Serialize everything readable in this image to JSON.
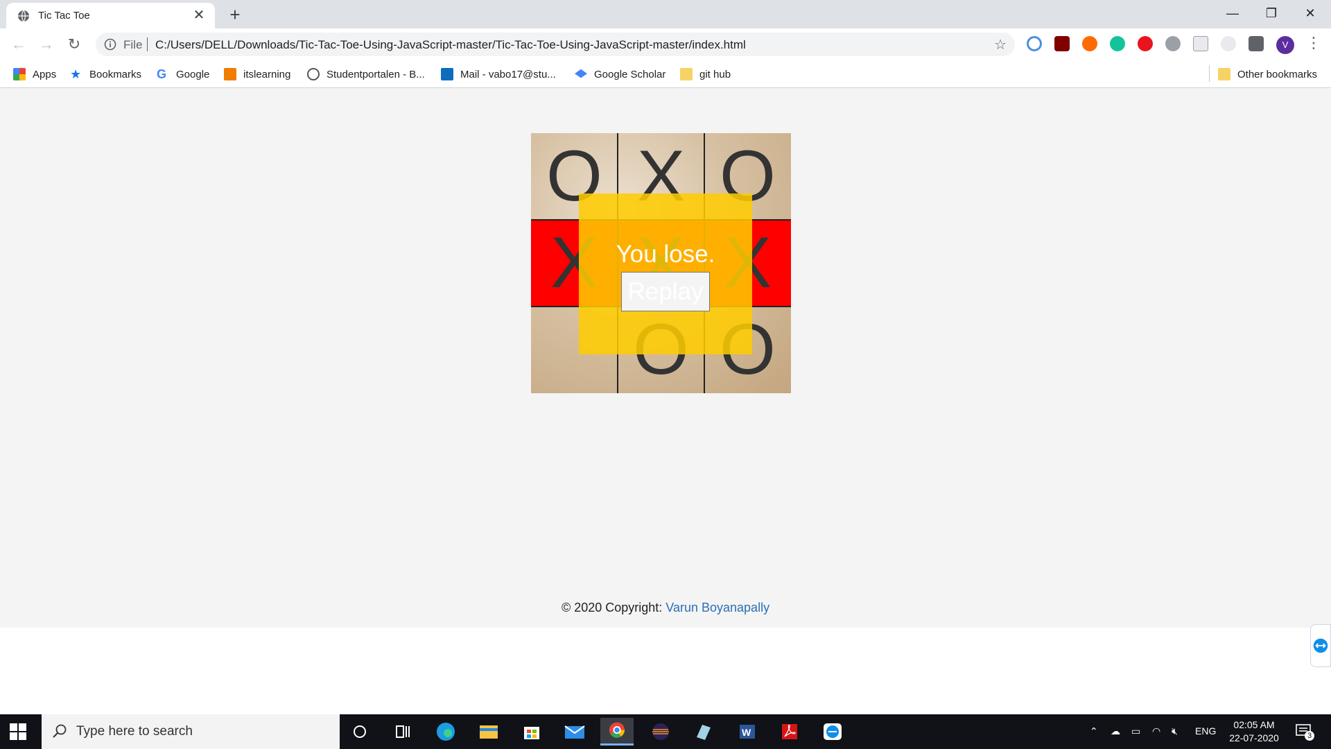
{
  "browser": {
    "tab_title": "Tic Tac Toe",
    "tab_close": "✕",
    "new_tab": "+",
    "window_minimize": "—",
    "window_restore": "❐",
    "window_close": "✕",
    "scheme_label": "File",
    "url": "C:/Users/DELL/Downloads/Tic-Tac-Toe-Using-JavaScript-master/Tic-Tac-Toe-Using-JavaScript-master/index.html",
    "profile_initial": "V",
    "bookmarks": [
      {
        "label": "Apps",
        "icon": "apps-grid-icon",
        "color": "#ea4335"
      },
      {
        "label": "Bookmarks",
        "icon": "star-icon",
        "color": "#1a73e8"
      },
      {
        "label": "Google",
        "icon": "google-icon",
        "color": "#4285f4"
      },
      {
        "label": "itslearning",
        "icon": "itslearning-icon",
        "color": "#f07c00"
      },
      {
        "label": "Studentportalen - B...",
        "icon": "studentportalen-icon",
        "color": "#555555"
      },
      {
        "label": "Mail - vabo17@stu...",
        "icon": "outlook-icon",
        "color": "#0f6cbd"
      },
      {
        "label": "Google Scholar",
        "icon": "scholar-icon",
        "color": "#4285f4"
      },
      {
        "label": "git hub",
        "icon": "folder-icon",
        "color": "#f6d365"
      }
    ],
    "other_bookmarks": "Other bookmarks"
  },
  "game": {
    "board": [
      "O",
      "X",
      "O",
      "X",
      "X",
      "X",
      "",
      "O",
      "O"
    ],
    "winning_row": [
      3,
      4,
      5
    ],
    "result_text": "You lose.",
    "replay_label": "Replay"
  },
  "footer": {
    "copyright_prefix": "© 2020 Copyright: ",
    "author": "Varun Boyanapally"
  },
  "taskbar": {
    "search_placeholder": "Type here to search",
    "language": "ENG",
    "time": "02:05 AM",
    "date": "22-07-2020",
    "notifications_count": "3"
  },
  "colors": {
    "win_highlight": "#ff0000",
    "overlay": "#ffcc00",
    "link": "#2a6fb5"
  }
}
